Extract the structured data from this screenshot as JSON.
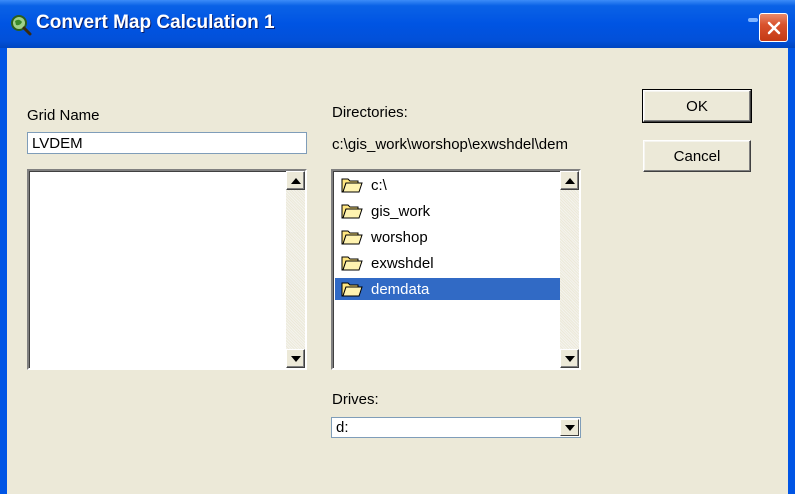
{
  "window": {
    "title": "Convert Map Calculation 1",
    "accent_color": "#0054e3",
    "close_color": "#d9522d"
  },
  "grid": {
    "label": "Grid Name",
    "value": "LVDEM",
    "list_items": []
  },
  "directories": {
    "label": "Directories:",
    "current_path": "c:\\gis_work\\worshop\\exwshdel\\dem",
    "items": [
      {
        "label": "c:\\",
        "icon": "folder-open-icon"
      },
      {
        "label": "gis_work",
        "icon": "folder-open-icon"
      },
      {
        "label": "worshop",
        "icon": "folder-open-icon"
      },
      {
        "label": "exwshdel",
        "icon": "folder-open-icon"
      },
      {
        "label": "demdata",
        "icon": "folder-open-icon",
        "selected": true
      }
    ],
    "selection_color": "#316ac5"
  },
  "drives": {
    "label": "Drives:",
    "selected": "d:"
  },
  "buttons": {
    "ok": "OK",
    "cancel": "Cancel"
  }
}
